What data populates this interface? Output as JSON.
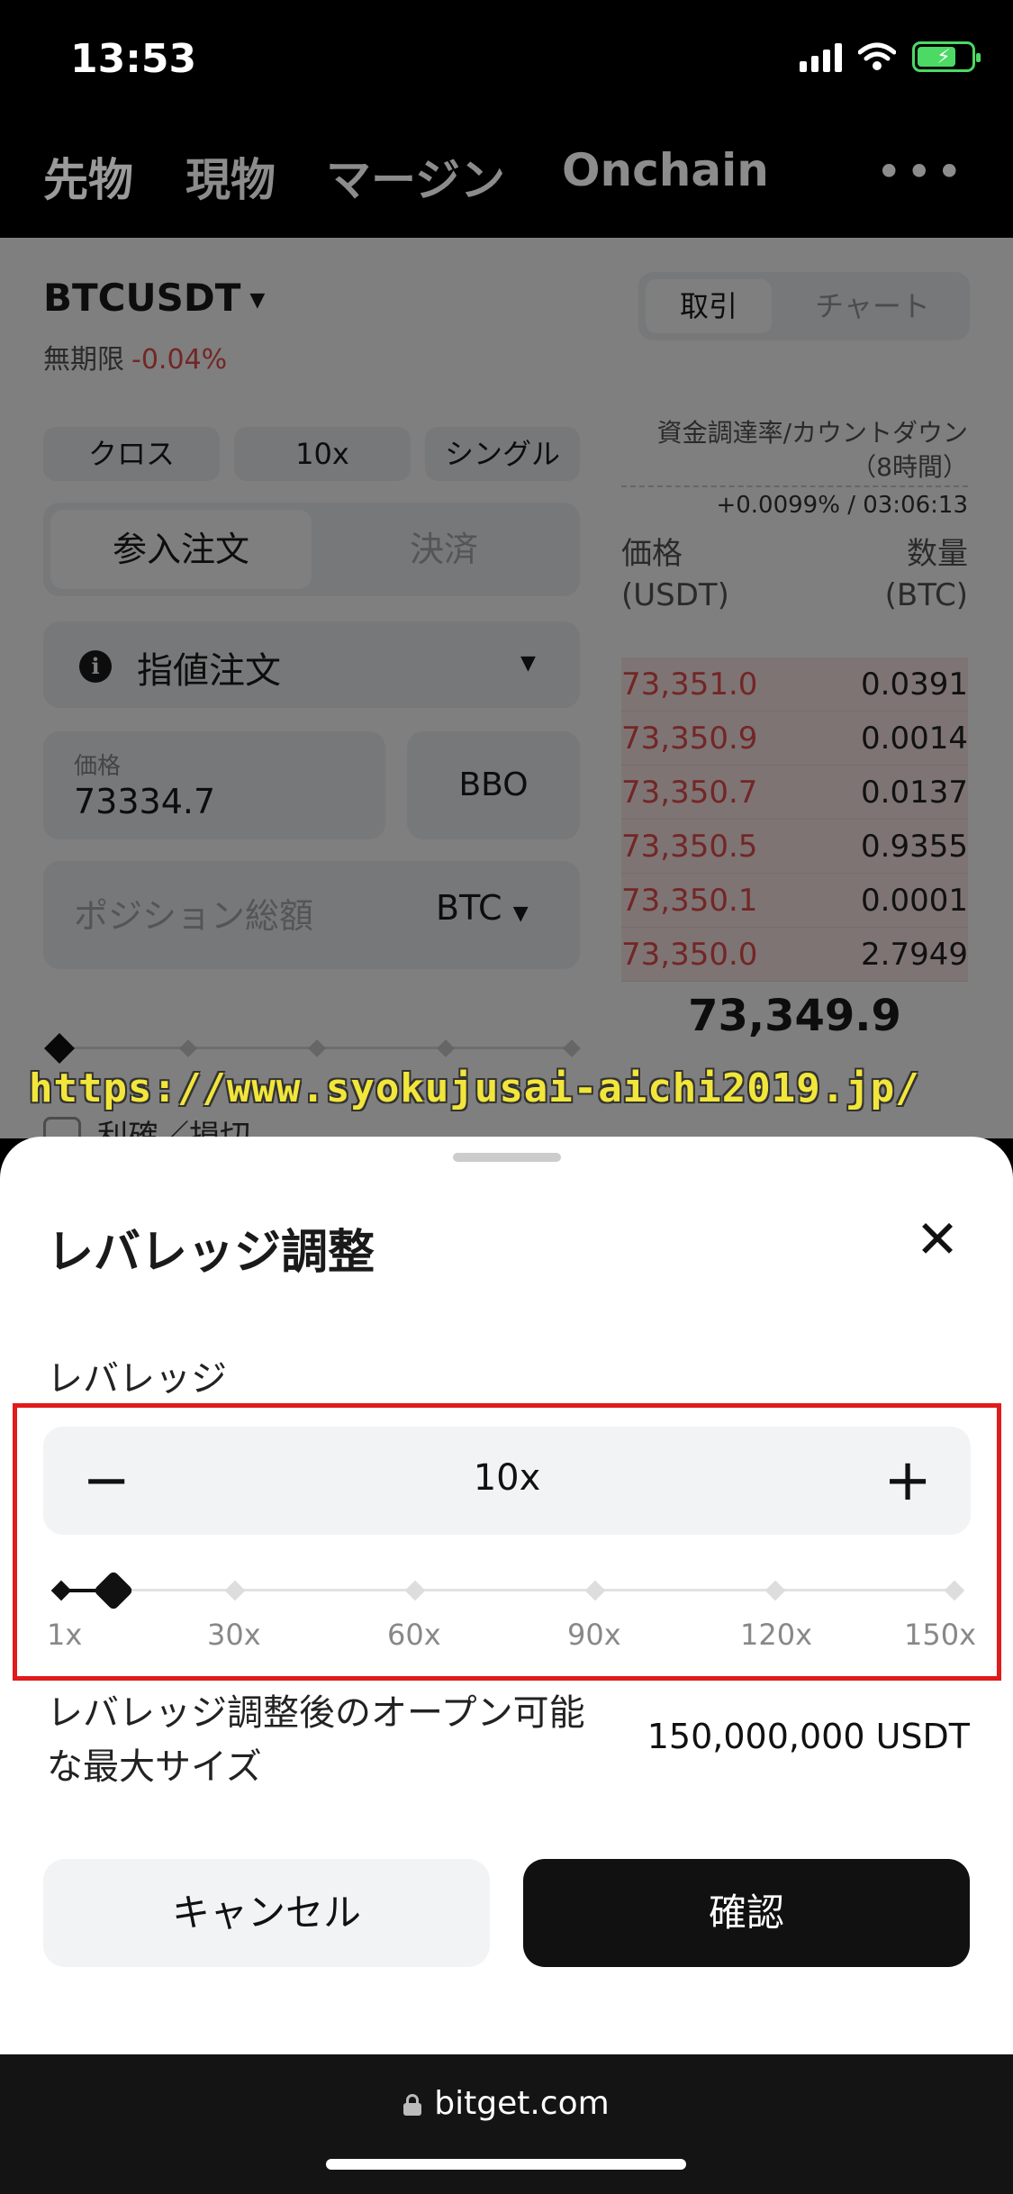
{
  "status_bar": {
    "time": "13:53"
  },
  "top_nav": {
    "tabs": [
      "先物",
      "現物",
      "マージン",
      "Onchain"
    ],
    "more": "•••"
  },
  "trading": {
    "pair": "BTCUSDT",
    "perpetual_label": "無期限",
    "change": "-0.04%",
    "view_tabs": {
      "active": "取引",
      "inactive": "チャート"
    },
    "margin_mode": "クロス",
    "leverage_chip": "10x",
    "position_mode": "シングル",
    "order_tabs": {
      "active": "参入注文",
      "inactive": "決済"
    },
    "order_type": "指値注文",
    "price_label": "価格",
    "price_value": "73334.7",
    "bbo": "BBO",
    "size_placeholder": "ポジション総額",
    "size_unit": "BTC",
    "tp_sl_label": "利確／損切"
  },
  "orderbook": {
    "funding_label": "資金調達率/カウントダウン\n（8時間）",
    "funding_value": "+0.0099% / 03:06:13",
    "price_header": "価格\n(USDT)",
    "qty_header": "数量\n(BTC)",
    "asks": [
      {
        "price": "73,351.0",
        "qty": "0.0391"
      },
      {
        "price": "73,350.9",
        "qty": "0.0014"
      },
      {
        "price": "73,350.7",
        "qty": "0.0137"
      },
      {
        "price": "73,350.5",
        "qty": "0.9355"
      },
      {
        "price": "73,350.1",
        "qty": "0.0001"
      },
      {
        "price": "73,350.0",
        "qty": "2.7949"
      }
    ],
    "last_price": "73,349.9"
  },
  "watermark": "https://www.syokujusai-aichi2019.jp/",
  "sheet": {
    "title": "レバレッジ調整",
    "close": "✕",
    "leverage_label": "レバレッジ",
    "minus": "−",
    "value": "10x",
    "plus": "+",
    "slider_ticks": [
      "1x",
      "30x",
      "60x",
      "90x",
      "120x",
      "150x"
    ],
    "slider_value": 10,
    "max_size_label": "レバレッジ調整後のオープン可能な最大サイズ",
    "max_size_value": "150,000,000 USDT",
    "cancel": "キャンセル",
    "confirm": "確認",
    "colors": {
      "highlight": "#e11b1b",
      "battery": "#4cd964",
      "negative": "#e74c4c"
    }
  },
  "browser": {
    "url": "bitget.com"
  }
}
